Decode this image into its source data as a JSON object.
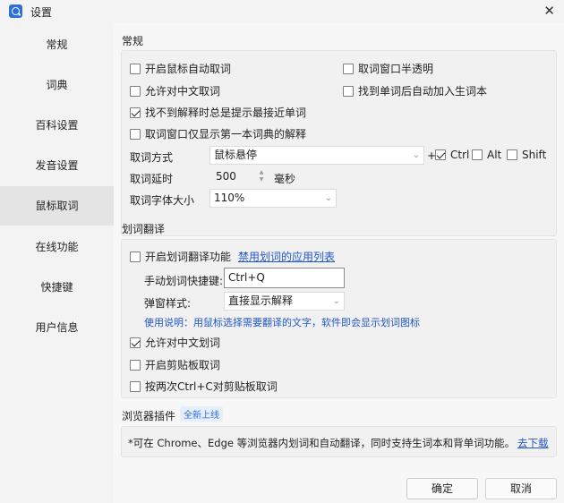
{
  "window": {
    "title": "设置"
  },
  "sidebar": {
    "items": [
      {
        "label": "常规"
      },
      {
        "label": "词典"
      },
      {
        "label": "百科设置"
      },
      {
        "label": "发音设置"
      },
      {
        "label": "鼠标取词"
      },
      {
        "label": "在线功能"
      },
      {
        "label": "快捷键"
      },
      {
        "label": "用户信息"
      }
    ],
    "active_index": 4
  },
  "general": {
    "title": "常规",
    "options": {
      "auto_pick": {
        "label": "开启鼠标自动取词",
        "checked": false
      },
      "semi_transparent": {
        "label": "取词窗口半透明",
        "checked": false
      },
      "allow_chinese": {
        "label": "允许对中文取词",
        "checked": false
      },
      "auto_add_vocab": {
        "label": "找到单词后自动加入生词本",
        "checked": false
      },
      "suggest_nearest": {
        "label": "找不到解释时总是提示最接近单词",
        "checked": true
      },
      "first_dict_only": {
        "label": "取词窗口仅显示第一本词典的解释",
        "checked": false
      }
    },
    "method": {
      "label": "取词方式",
      "value": "鼠标悬停",
      "plus": "+"
    },
    "modifiers": {
      "ctrl": {
        "label": "Ctrl",
        "checked": true
      },
      "alt": {
        "label": "Alt",
        "checked": false
      },
      "shift": {
        "label": "Shift",
        "checked": false
      }
    },
    "delay": {
      "label": "取词延时",
      "value": "500",
      "unit": "毫秒"
    },
    "font_size": {
      "label": "取词字体大小",
      "value": "110%"
    }
  },
  "selection": {
    "title": "划词翻译",
    "enable": {
      "label": "开启划词翻译功能",
      "checked": false
    },
    "disabled_apps_link": "禁用划词的应用列表",
    "hotkey": {
      "label": "手动划词快捷键:",
      "value": "Ctrl+Q"
    },
    "popup": {
      "label": "弹窗样式:",
      "value": "直接显示解释"
    },
    "hint": "使用说明：用鼠标选择需要翻译的文字，软件即会显示划词图标",
    "allow_chinese": {
      "label": "允许对中文划词",
      "checked": true
    },
    "clipboard": {
      "label": "开启剪贴板取词",
      "checked": false
    },
    "double_ctrl_c": {
      "label": "按两次Ctrl+C对剪贴板取词",
      "checked": false
    }
  },
  "browser": {
    "title": "浏览器插件",
    "badge": "全新上线",
    "desc": "*可在 Chrome、Edge 等浏览器内划词和自动翻译，同时支持生词本和背单词功能。",
    "link": "去下载"
  },
  "footer": {
    "ok": "确定",
    "cancel": "取消"
  }
}
